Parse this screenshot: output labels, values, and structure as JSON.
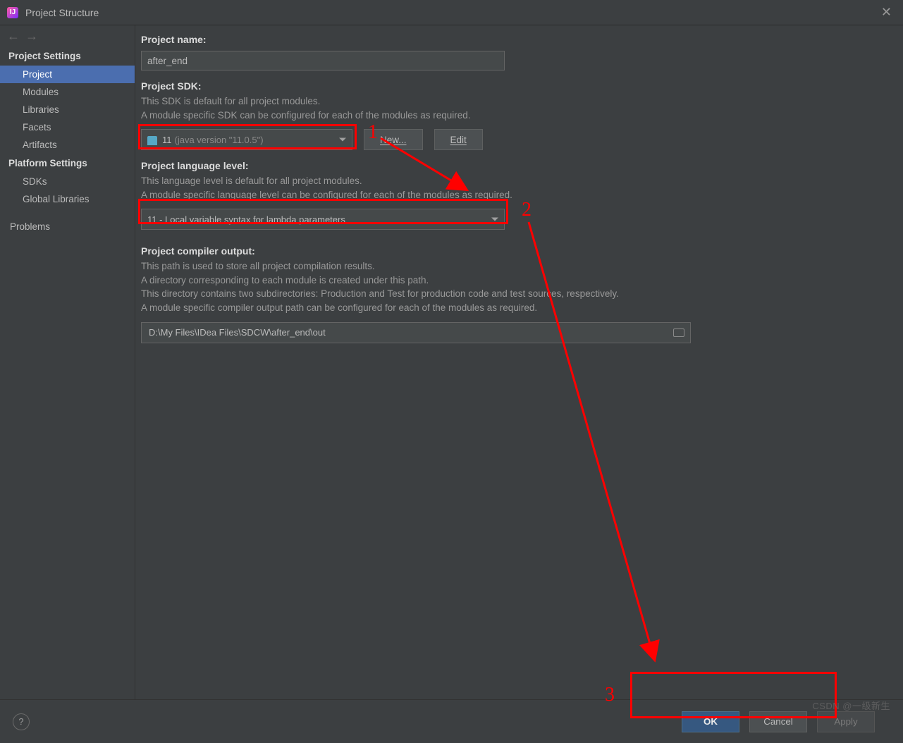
{
  "window": {
    "title": "Project Structure"
  },
  "sidebar": {
    "section_project": "Project Settings",
    "section_platform": "Platform Settings",
    "items": {
      "project": "Project",
      "modules": "Modules",
      "libraries": "Libraries",
      "facets": "Facets",
      "artifacts": "Artifacts",
      "sdks": "SDKs",
      "global_libs": "Global Libraries",
      "problems": "Problems"
    }
  },
  "main": {
    "project_name": {
      "label": "Project name:",
      "value": "after_end"
    },
    "project_sdk": {
      "label": "Project SDK:",
      "desc1": "This SDK is default for all project modules.",
      "desc2": "A module specific SDK can be configured for each of the modules as required.",
      "value_main": "11",
      "value_detail": " (java version \"11.0.5\")",
      "new_btn": "New...",
      "edit_btn": "Edit"
    },
    "lang_level": {
      "label": "Project language level:",
      "desc1": "This language level is default for all project modules.",
      "desc2": "A module specific language level can be configured for each of the modules as required.",
      "value": "11 - Local variable syntax for lambda parameters"
    },
    "compiler_out": {
      "label": "Project compiler output:",
      "desc1": "This path is used to store all project compilation results.",
      "desc2": "A directory corresponding to each module is created under this path.",
      "desc3": "This directory contains two subdirectories: Production and Test for production code and test sources, respectively.",
      "desc4": "A module specific compiler output path can be configured for each of the modules as required.",
      "value": "D:\\My Files\\IDea Files\\SDCW\\after_end\\out"
    }
  },
  "buttons": {
    "ok": "OK",
    "cancel": "Cancel",
    "apply": "Apply"
  },
  "annotations": {
    "n1": "1",
    "n2": "2",
    "n3": "3"
  },
  "watermark": "CSDN @一级新生"
}
